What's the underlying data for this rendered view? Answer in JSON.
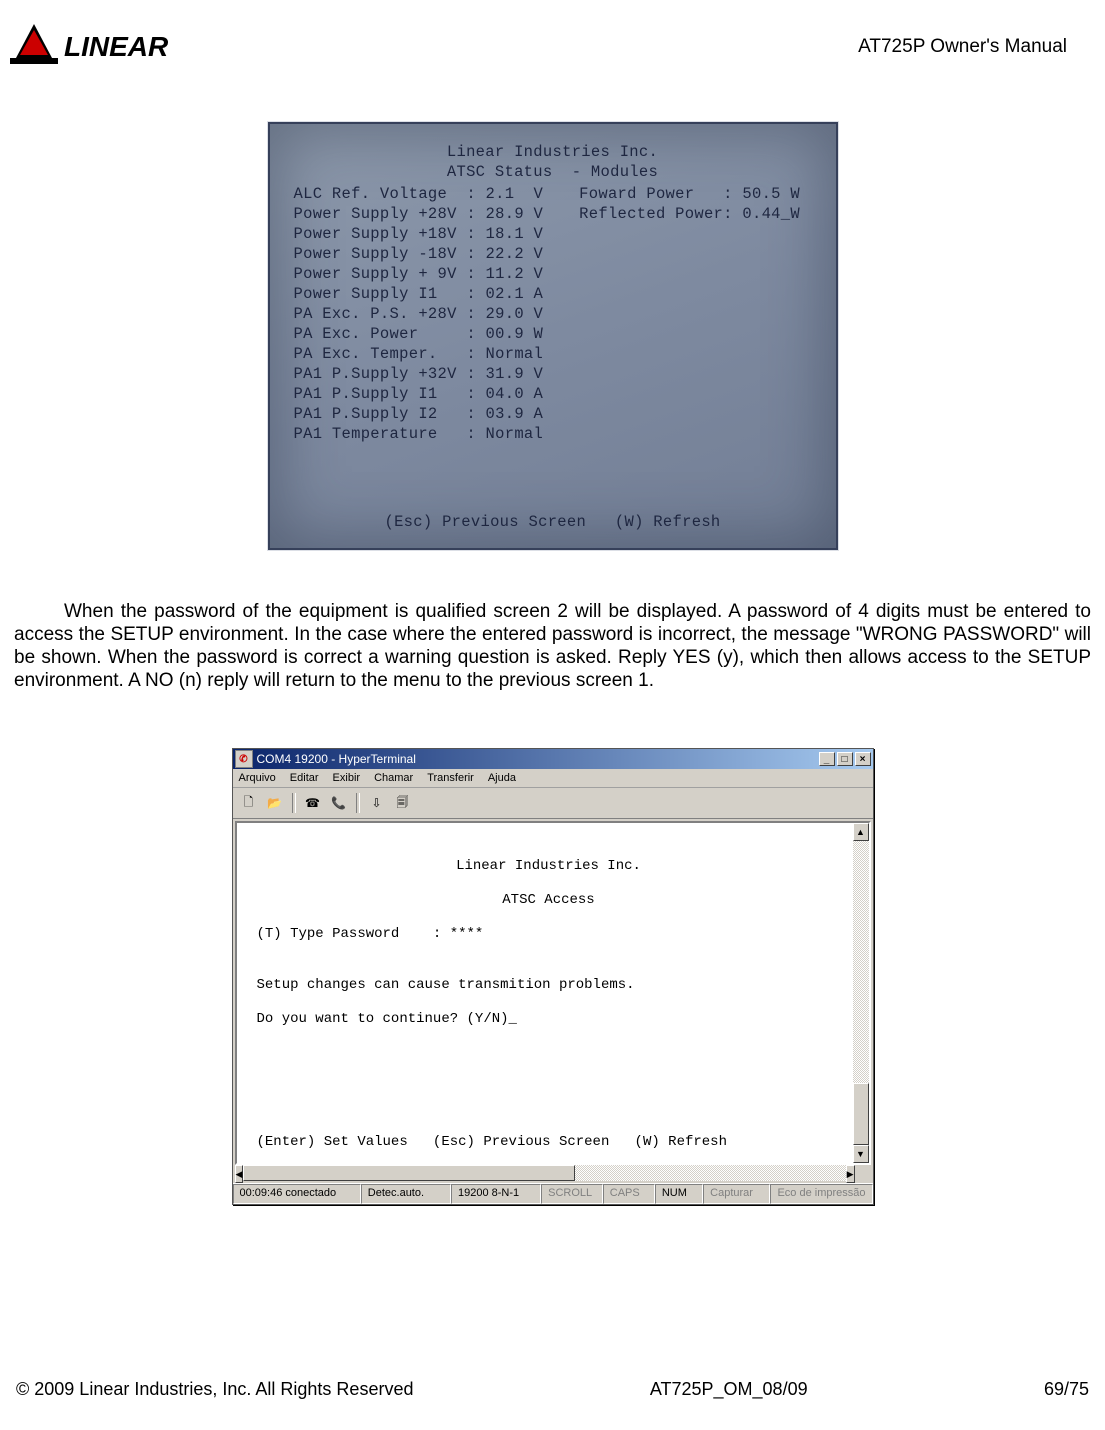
{
  "header": {
    "brand": "LINEAR",
    "title": "AT725P Owner's Manual"
  },
  "crt": {
    "line1": "Linear Industries Inc.",
    "line2": "ATSC Status  - Modules",
    "left_rows": [
      "ALC Ref. Voltage  : 2.1  V",
      "Power Supply +28V : 28.9 V",
      "Power Supply +18V : 18.1 V",
      "Power Supply -18V : 22.2 V",
      "Power Supply + 9V : 11.2 V",
      "Power Supply I1   : 02.1 A",
      "PA Exc. P.S. +28V : 29.0 V",
      "PA Exc. Power     : 00.9 W",
      "PA Exc. Temper.   : Normal",
      "",
      "PA1 P.Supply +32V : 31.9 V",
      "PA1 P.Supply I1   : 04.0 A",
      "PA1 P.Supply I2   : 03.9 A",
      "PA1 Temperature   : Normal"
    ],
    "right_rows": [
      "Foward Power   : 50.5 W",
      "Reflected Power: 0.44_W"
    ],
    "bottom": "(Esc) Previous Screen   (W) Refresh"
  },
  "paragraph": "When the password of the equipment is qualified screen 2 will be displayed. A password of 4 digits must be entered to access the SETUP environment. In the case where the entered password is incorrect, the message \"WRONG PASSWORD\" will be shown. When the password is correct a warning question is asked. Reply YES (y), which then allows access to the SETUP environment. A NO (n) reply will return to the menu to the previous screen 1.",
  "hyperterm": {
    "title": "COM4 19200 - HyperTerminal",
    "menus": [
      "Arquivo",
      "Editar",
      "Exibir",
      "Chamar",
      "Transferir",
      "Ajuda"
    ],
    "term": {
      "l1": "Linear Industries Inc.",
      "l2": "ATSC Access",
      "l3": "(T) Type Password    : ****",
      "blank": "",
      "l4": "Setup changes can cause transmition problems.",
      "l5": "Do you want to continue? (Y/N)_",
      "bottom": "(Enter) Set Values   (Esc) Previous Screen   (W) Refresh"
    },
    "status": {
      "c1": "00:09:46 conectado",
      "c2": "Detec.auto.",
      "c3": "19200 8-N-1",
      "c4": "SCROLL",
      "c5": "CAPS",
      "c6": "NUM",
      "c7": "Capturar",
      "c8": "Eco de impressão"
    },
    "buttons": {
      "min": "_",
      "max": "□",
      "close": "×"
    }
  },
  "footer": {
    "left": "© 2009 Linear Industries, Inc.  All Rights Reserved",
    "center": "AT725P_OM_08/09",
    "right": "69/75"
  }
}
